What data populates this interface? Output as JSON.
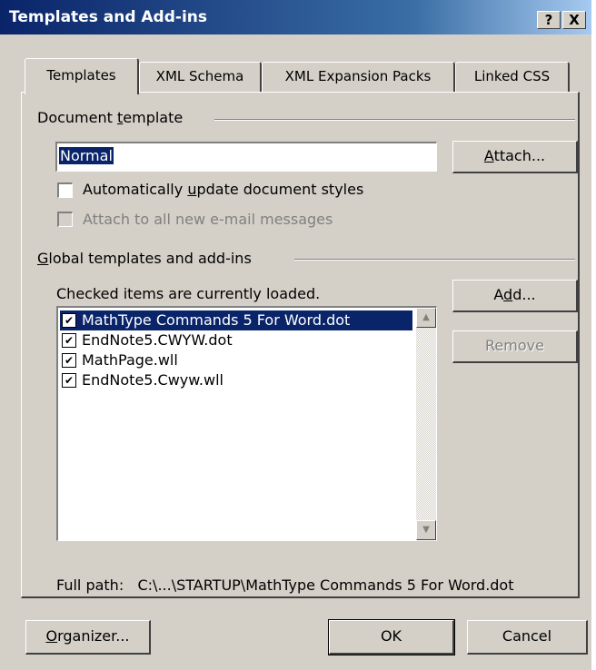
{
  "window": {
    "title": "Templates and Add-ins",
    "help_glyph": "?",
    "close_glyph": "X"
  },
  "tabs": [
    {
      "label": "Templates",
      "active": true
    },
    {
      "label": "XML Schema",
      "active": false
    },
    {
      "label": "XML Expansion Packs",
      "active": false
    },
    {
      "label": "Linked CSS",
      "active": false
    }
  ],
  "document_template": {
    "group_label_pre": "Document ",
    "group_label_mnemonic": "t",
    "group_label_post": "emplate",
    "value": "Normal",
    "attach_pre": "",
    "attach_mnemonic": "A",
    "attach_post": "ttach...",
    "auto_update_pre": "Automatically ",
    "auto_update_mnemonic": "u",
    "auto_update_post": "pdate document styles",
    "auto_update_checked": false,
    "attach_email_label": "Attach to all new e-mail messages",
    "attach_email_checked": false
  },
  "global_templates": {
    "group_label_mnemonic": "G",
    "group_label_post": "lobal templates and add-ins",
    "hint": "Checked items are currently loaded.",
    "items": [
      {
        "label": "MathType Commands 5 For Word.dot",
        "checked": "✔"
      },
      {
        "label": "EndNote5.CWYW.dot",
        "checked": "✔"
      },
      {
        "label": "MathPage.wll",
        "checked": "✔"
      },
      {
        "label": "EndNote5.Cwyw.wll",
        "checked": "✔"
      }
    ],
    "add_pre": "A",
    "add_mnemonic": "d",
    "add_post": "d...",
    "remove_label": "Remove",
    "full_path_label": "Full path:",
    "full_path_value": "C:\\...\\STARTUP\\MathType Commands 5 For Word.dot"
  },
  "footer": {
    "organizer_mnemonic": "O",
    "organizer_post": "rganizer...",
    "ok_label": "OK",
    "cancel_label": "Cancel"
  },
  "icons": {
    "scroll_up": "▲",
    "scroll_down": "▼"
  },
  "colors": {
    "title_start": "#0a246a",
    "title_end": "#a6caf0",
    "face": "#d4d0c8",
    "selection": "#0a246a"
  }
}
